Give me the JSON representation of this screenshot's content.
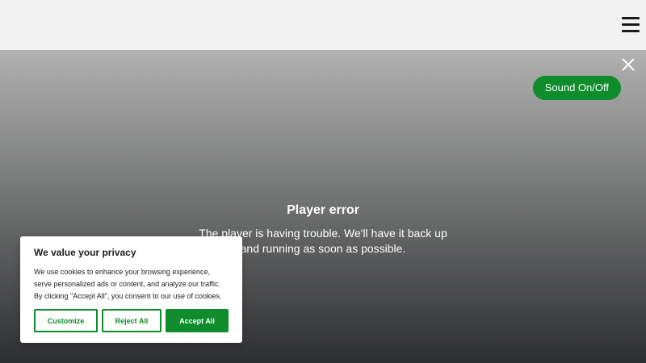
{
  "header": {
    "menu_icon": "hamburger-menu-icon"
  },
  "player": {
    "close_icon": "close-icon",
    "sound_button_label": "Sound On/Off",
    "error_title": "Player error",
    "error_message": "The player is having trouble. We'll have it back up and running as soon as possible."
  },
  "cookie_banner": {
    "title": "We value your privacy",
    "text": "We use cookies to enhance your browsing experience, serve personalized ads or content, and analyze our traffic. By clicking \"Accept All\", you consent to our use of cookies.",
    "customize_label": "Customize",
    "reject_label": "Reject All",
    "accept_label": "Accept All"
  },
  "colors": {
    "accent": "#0f8c2c",
    "topbar_bg": "#f2f2f2",
    "text_dark": "#212121"
  }
}
